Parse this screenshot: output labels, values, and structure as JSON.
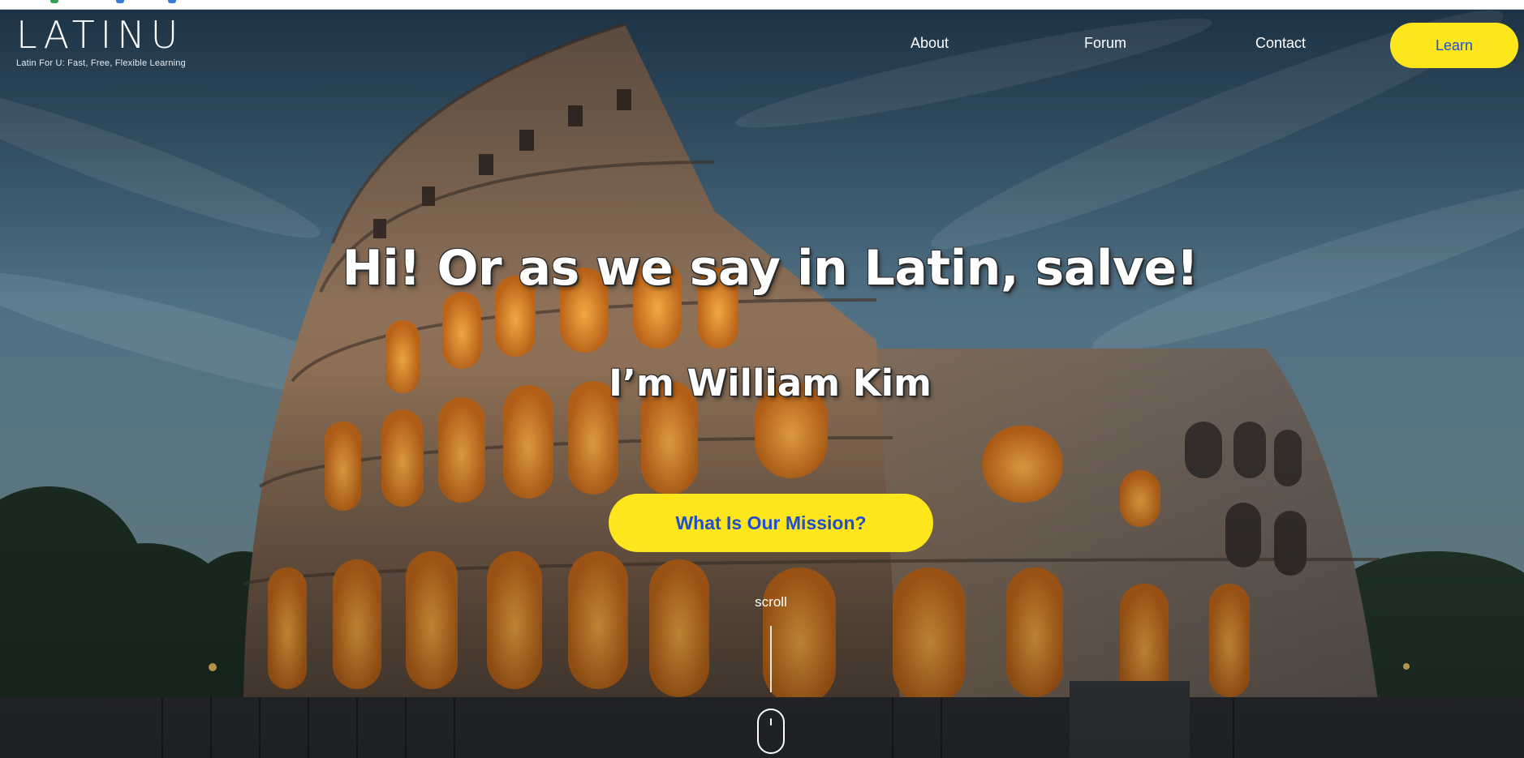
{
  "brand": {
    "logo_text": "LATINU",
    "tagline": "Latin For U: Fast, Free, Flexible Learning"
  },
  "nav": {
    "links": [
      "About",
      "Forum",
      "Contact"
    ],
    "cta_label": "Learn"
  },
  "hero": {
    "headline": "Hi! Or as we say in Latin, salve!",
    "subheadline": "I’m William Kim",
    "button_label": "What Is Our Mission?",
    "scroll_label": "scroll",
    "background_icon": "colosseum-photo"
  },
  "colors": {
    "accent_yellow": "#fde61c",
    "button_text_blue": "#1f4fd0",
    "text_white": "#ffffff"
  }
}
